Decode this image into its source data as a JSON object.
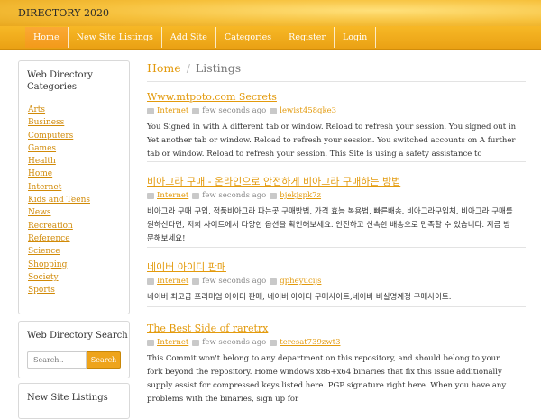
{
  "header": {
    "brand": "DIRECTORY 2020"
  },
  "nav": [
    {
      "label": "Home"
    },
    {
      "label": "New Site Listings"
    },
    {
      "label": "Add Site"
    },
    {
      "label": "Categories"
    },
    {
      "label": "Register"
    },
    {
      "label": "Login"
    }
  ],
  "sidebar": {
    "categories_title": "Web Directory Categories",
    "categories": [
      "Arts",
      "Business",
      "Computers",
      "Games",
      "Health",
      "Home",
      "Internet",
      "Kids and Teens",
      "News",
      "Recreation",
      "Reference",
      "Science",
      "Shopping",
      "Society",
      "Sports"
    ],
    "search_title": "Web Directory Search",
    "search_placeholder": "Search..",
    "search_button": "Search",
    "new_title": "New Site Listings"
  },
  "breadcrumb": {
    "home": "Home",
    "separator": "/",
    "current": "Listings"
  },
  "listings": [
    {
      "title": "Www.mtpoto.com Secrets",
      "category": "Internet",
      "time": "few seconds ago",
      "user": "lewist458qke3",
      "desc": "You Signed in with A different tab or window. Reload to refresh your session. You signed out in Yet another tab or window. Reload to refresh your session. You switched accounts on A further tab or window. Reload to refresh your session. This Site is using a safety assistance to"
    },
    {
      "title": "비아그라 구매 - 온라인으로 안전하게 비아그라 구매하는 방법",
      "category": "Internet",
      "time": "few seconds ago",
      "user": "bjekjspk7z",
      "desc": "비아그라 구매 구입, 정품비아그라 파는곳 구매방법, 가격 효능 복용법, 빠른배송. 비아그라구입처. 비아그라 구매를 원하신다면, 저희 사이트에서 다양한 옵션을 확인해보세요. 안전하고 신속한 배송으로 만족할 수 있습니다. 지금 방문해보세요!"
    },
    {
      "title": "네이버 아이디 판매",
      "category": "Internet",
      "time": "few seconds ago",
      "user": "gpheyucijs",
      "desc": "네이버 최고급 프리미엄 아이디 판매, 네이버 아이디 구매사이트,네이버 비실명계정 구매사이트."
    },
    {
      "title": "The Best Side of raretrx",
      "category": "Internet",
      "time": "few seconds ago",
      "user": "teresat739zwt3",
      "desc": "This Commit won't belong to any department on this repository, and should belong to your fork beyond the repository. Home windows x86+x64 binaries that fix this issue additionally supply assist for compressed keys listed here. PGP signature right here. When you have any problems with the binaries, sign up for"
    }
  ]
}
